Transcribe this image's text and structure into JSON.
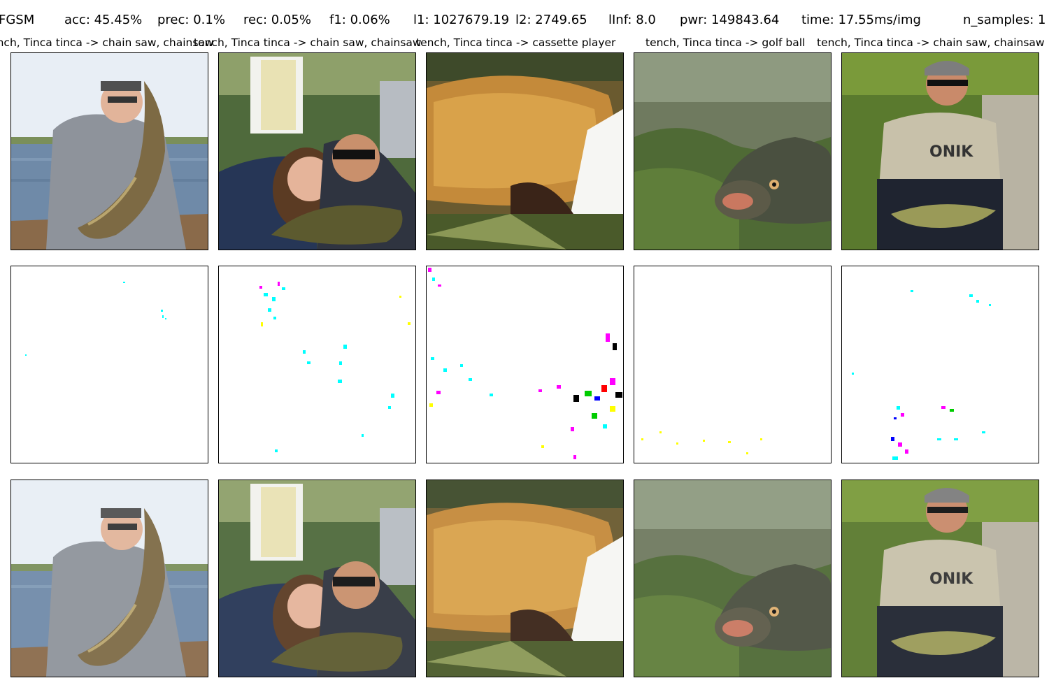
{
  "header": {
    "method": "FGSM",
    "acc": "acc: 45.45%",
    "prec": "prec: 0.1%",
    "rec": "rec: 0.05%",
    "f1": "f1: 0.06%",
    "l1": "l1: 1027679.19",
    "l2": "l2: 2749.65",
    "linf": "lInf: 8.0",
    "pwr": "pwr: 149843.64",
    "time": "time: 17.55ms/img",
    "n_samples": "n_samples: 1"
  },
  "columns": [
    {
      "label": "tench, Tinca tinca -> chain saw, chainsaw",
      "subject": "man holding pike fish on boat"
    },
    {
      "label": "tench, Tinca tinca -> chain saw, chainsaw",
      "subject": "girl and man with sunglasses holding tench"
    },
    {
      "label": "tench, Tinca tinca -> cassette player",
      "subject": "close-up of golden tench in hands"
    },
    {
      "label": "tench, Tinca tinca -> golf ball",
      "subject": "underwater tench among weeds"
    },
    {
      "label": "tench, Tinca tinca -> chain saw, chainsaw",
      "subject": "man in cap and sunglasses holding tench"
    }
  ],
  "rows": [
    {
      "name": "original"
    },
    {
      "name": "perturbation"
    },
    {
      "name": "adversarial"
    }
  ],
  "colors": {
    "perturbation_cyan": "#00ffff",
    "perturbation_magenta": "#ff00ff",
    "perturbation_yellow": "#ffff00",
    "perturbation_green": "#00cc00",
    "perturbation_blue": "#0000ff",
    "perturbation_red": "#ff0000",
    "border": "#000000",
    "background": "#ffffff"
  }
}
